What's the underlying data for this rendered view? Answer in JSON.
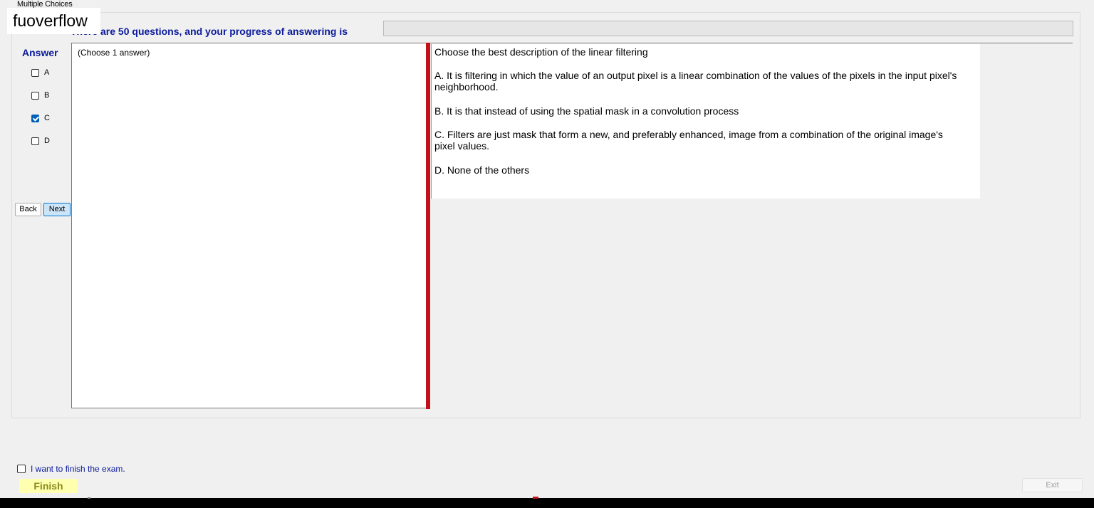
{
  "window": {
    "group_title": "Multiple Choices",
    "watermark": "fuoverflow"
  },
  "progress": {
    "text": "There are 50 questions, and your progress of answering is",
    "fraction": 0.0
  },
  "answer_panel": {
    "heading": "Answer",
    "options": [
      {
        "label": "A",
        "checked": false
      },
      {
        "label": "B",
        "checked": false
      },
      {
        "label": "C",
        "checked": true
      },
      {
        "label": "D",
        "checked": false
      }
    ],
    "back_label": "Back",
    "next_label": "Next"
  },
  "left_pane": {
    "instruction": "(Choose 1 answer)"
  },
  "question": {
    "stem": "Choose the best description of the linear filtering",
    "choices": [
      "A.  It is filtering in which the value of an output pixel is a linear combination of the values of the pixels in the input pixel's neighborhood.",
      "B.  It is that instead of using the spatial mask in a convolution process",
      "C.  Filters are just mask that form a new, and preferably enhanced, image from a combination of the original image's pixel values.",
      "D.  None of the others"
    ]
  },
  "footer": {
    "finish_checkbox_label": "I want to finish the exam.",
    "finish_checked": false,
    "finish_label": "Finish",
    "exit_label": "Exit"
  },
  "colors": {
    "heading_blue": "#0a1a9a",
    "splitter_red": "#c1121c",
    "finish_yellow": "#ffffb0",
    "checkbox_accent": "#005fb8"
  }
}
